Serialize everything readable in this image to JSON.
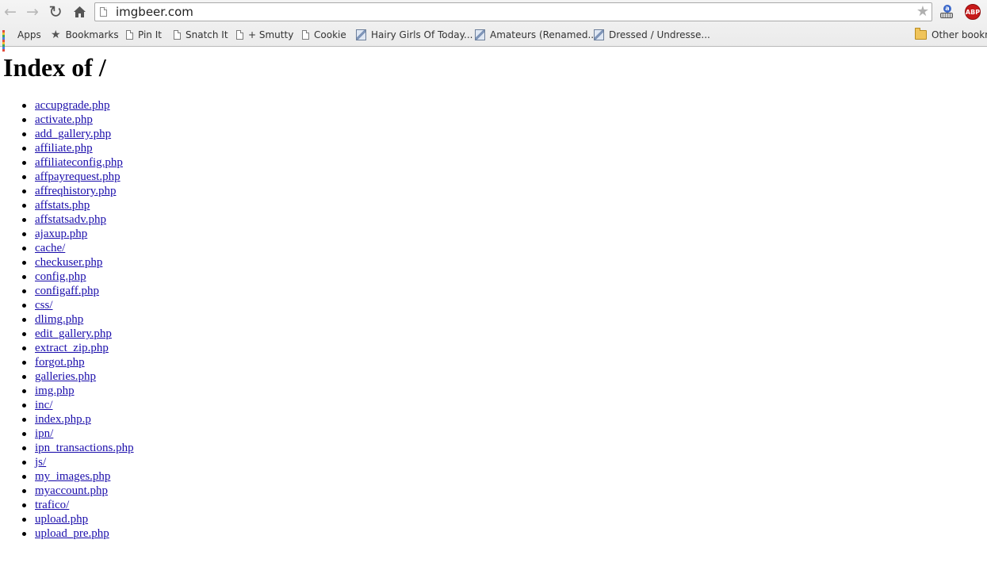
{
  "browser": {
    "url": "imgbeer.com",
    "bookmarks": [
      {
        "label": "Apps",
        "icon": "apps-grid-icon"
      },
      {
        "label": "Bookmarks",
        "icon": "star-icon"
      },
      {
        "label": "Pin It",
        "icon": "page-icon"
      },
      {
        "label": "Snatch It",
        "icon": "page-icon"
      },
      {
        "label": "+ Smutty",
        "icon": "page-icon"
      },
      {
        "label": "Cookie",
        "icon": "page-icon"
      },
      {
        "label": "Hairy Girls Of Today...",
        "icon": "image-thumbnail-icon"
      },
      {
        "label": "Amateurs (Renamed...",
        "icon": "image-thumbnail-icon"
      },
      {
        "label": "Dressed / Undresse...",
        "icon": "image-thumbnail-icon"
      }
    ],
    "other_bookmarks": "Other bookm",
    "abp_label": "ABP",
    "apps_colors": [
      "#e04b3c",
      "#f2b92e",
      "#3ba55d",
      "#4a7de2",
      "#e04b3c",
      "#f2b92e",
      "#3ba55d",
      "#4a7de2",
      "#e04b3c"
    ]
  },
  "page": {
    "title": "Index of /",
    "link_color": "#1a0dab",
    "files": [
      "accupgrade.php",
      "activate.php",
      "add_gallery.php",
      "affiliate.php",
      "affiliateconfig.php",
      "affpayrequest.php",
      "affreqhistory.php",
      "affstats.php",
      "affstatsadv.php",
      "ajaxup.php",
      "cache/",
      "checkuser.php",
      "config.php",
      "configaff.php",
      "css/",
      "dlimg.php",
      "edit_gallery.php",
      "extract_zip.php",
      "forgot.php",
      "galleries.php",
      "img.php",
      "inc/",
      "index.php.p",
      "ipn/",
      "ipn_transactions.php",
      "js/",
      "my_images.php",
      "myaccount.php",
      "trafico/",
      "upload.php",
      "upload_pre.php"
    ]
  }
}
